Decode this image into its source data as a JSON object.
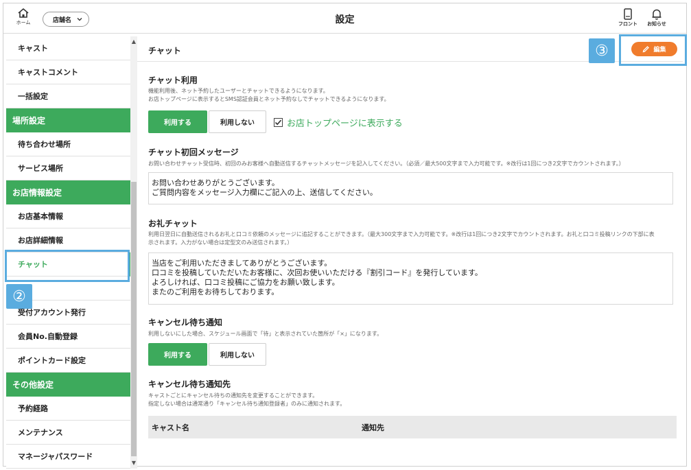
{
  "header": {
    "home_label": "ホーム",
    "store_selector": "店舗名",
    "title": "設定",
    "front_label": "フロント",
    "notice_label": "お知らせ"
  },
  "sidebar": {
    "items": [
      {
        "label": "キャスト",
        "type": "item"
      },
      {
        "label": "キャストコメント",
        "type": "item"
      },
      {
        "label": "一括設定",
        "type": "item"
      },
      {
        "label": "場所設定",
        "type": "heading"
      },
      {
        "label": "待ち合わせ場所",
        "type": "item"
      },
      {
        "label": "サービス場所",
        "type": "item"
      },
      {
        "label": "お店情報設定",
        "type": "heading"
      },
      {
        "label": "お店基本情報",
        "type": "item"
      },
      {
        "label": "お店詳細情報",
        "type": "item"
      },
      {
        "label": "チャット",
        "type": "item",
        "active": true
      },
      {
        "label": "",
        "type": "item"
      },
      {
        "label": "受付アカウント発行",
        "type": "item"
      },
      {
        "label": "会員No.自動登録",
        "type": "item"
      },
      {
        "label": "ポイントカード設定",
        "type": "item"
      },
      {
        "label": "その他設定",
        "type": "heading"
      },
      {
        "label": "予約経路",
        "type": "item"
      },
      {
        "label": "メンテナンス",
        "type": "item"
      },
      {
        "label": "マネージャパスワード",
        "type": "item"
      }
    ]
  },
  "main": {
    "title": "チャット",
    "edit_label": "編集",
    "chat_use": {
      "title": "チャット利用",
      "desc1": "機能利用後、ネット予約したユーザーとチャットできるようになります。",
      "desc2": "お店トップページに表示するとSMS認証会員とネット予約なしでチャットできるようになります。",
      "use_label": "利用する",
      "nouse_label": "利用しない",
      "checkbox_label": "お店トップページに表示する",
      "checkbox_checked": true
    },
    "first_message": {
      "title": "チャット初回メッセージ",
      "desc": "お問い合わせチャット受信時、初回のみお客様へ自動送信するチャットメッセージを記入してください。（必須／最大500文字まで入力可能です。※改行は1回につき2文字でカウントされます。）",
      "line1": "お問い合わせありがとうございます。",
      "line2": "ご質問内容をメッセージ入力欄にご記入の上、送信してください。"
    },
    "thanks_chat": {
      "title": "お礼チャット",
      "desc1": "利用日翌日に自動送信されるお礼と口コミ依頼のメッセージに追記することができます。（最大300文字まで入力可能です。※改行は1回につき2文字でカウントされます。お礼と口コミ投稿リンクの下部に表",
      "desc2": "示されます。入力がない場合は定型文のみ送信されます。）",
      "line1": "当店をご利用いただきましてありがとうございます。",
      "line2": "口コミを投稿していただいたお客様に、次回お使いいただける『割引コード』を発行しています。",
      "line3": "よろしければ、口コミ投稿にご協力をお願い致します。",
      "line4": "またのご利用をお待ちしております。"
    },
    "cancel_wait": {
      "title": "キャンセル待ち通知",
      "desc": "利用しないにした場合、スケジュール画面で「待」と表示されていた箇所が「×」になります。",
      "use_label": "利用する",
      "nouse_label": "利用しない"
    },
    "cancel_dest": {
      "title": "キャンセル待ち通知先",
      "desc1": "キャストごとにキャンセル待ちの通知先を変更することができます。",
      "desc2": "指定しない場合は通常通り「キャンセル待ち通知登録者」のみに通知されます。",
      "col_cast": "キャスト名",
      "col_dest": "通知先"
    }
  },
  "annotations": {
    "step2": "②",
    "step3": "③"
  },
  "colors": {
    "accent_green": "#3daa5c",
    "edit_orange": "#f07c2c",
    "highlight_blue": "#5aacdf"
  }
}
